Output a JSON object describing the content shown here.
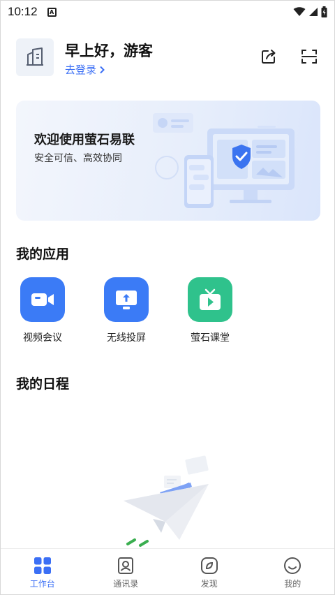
{
  "status_bar": {
    "time": "10:12",
    "notif_glyph": "A"
  },
  "header": {
    "greeting": "早上好，游客",
    "login_link": "去登录",
    "icons": [
      "share-icon",
      "scan-icon"
    ]
  },
  "banner": {
    "title": "欢迎使用萤石易联",
    "subtitle": "安全可信、高效协同"
  },
  "my_apps": {
    "title": "我的应用",
    "items": [
      {
        "label": "视频会议",
        "icon": "video-camera-icon",
        "color": "#3b7bf6"
      },
      {
        "label": "无线投屏",
        "icon": "screen-cast-icon",
        "color": "#3b7bf6"
      },
      {
        "label": "萤石课堂",
        "icon": "tv-play-icon",
        "color": "#2fc28c"
      }
    ]
  },
  "schedule": {
    "title": "我的日程"
  },
  "bottom_nav": {
    "items": [
      {
        "label": "工作台",
        "icon": "grid-icon",
        "active": true
      },
      {
        "label": "通讯录",
        "icon": "contacts-icon",
        "active": false
      },
      {
        "label": "发现",
        "icon": "compass-icon",
        "active": false
      },
      {
        "label": "我的",
        "icon": "smile-icon",
        "active": false
      }
    ]
  },
  "colors": {
    "accent": "#3b6ff5",
    "inactive": "#666666"
  }
}
